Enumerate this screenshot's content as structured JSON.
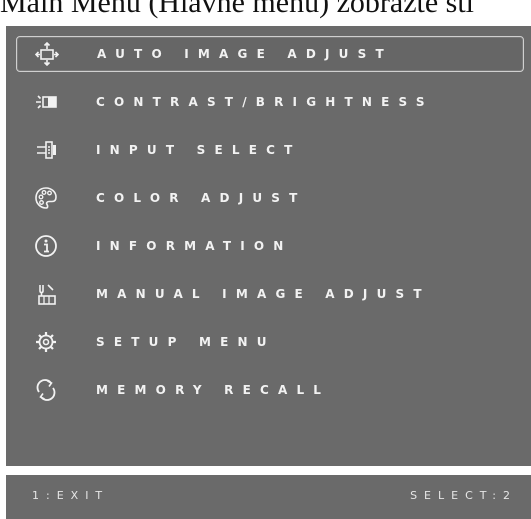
{
  "caption": "Main Menu (Hlavné menu) zobrazte stl",
  "menu": {
    "items": [
      {
        "label": "AUTO IMAGE ADJUST",
        "icon": "auto-adjust-icon",
        "selected": true
      },
      {
        "label": "CONTRAST/BRIGHTNESS",
        "icon": "contrast-brightness-icon",
        "selected": false
      },
      {
        "label": "INPUT SELECT",
        "icon": "input-select-icon",
        "selected": false
      },
      {
        "label": "COLOR ADJUST",
        "icon": "color-palette-icon",
        "selected": false
      },
      {
        "label": "INFORMATION",
        "icon": "info-icon",
        "selected": false
      },
      {
        "label": "MANUAL IMAGE ADJUST",
        "icon": "manual-adjust-icon",
        "selected": false
      },
      {
        "label": "SETUP MENU",
        "icon": "gear-icon",
        "selected": false
      },
      {
        "label": "MEMORY RECALL",
        "icon": "recall-icon",
        "selected": false
      }
    ]
  },
  "footer": {
    "exit_label": "1:EXIT",
    "select_label": "SELECT:2"
  },
  "colors": {
    "panel": "#6a6a6a",
    "text": "#f2f2f2",
    "selected_border": "#d0d0d0"
  }
}
